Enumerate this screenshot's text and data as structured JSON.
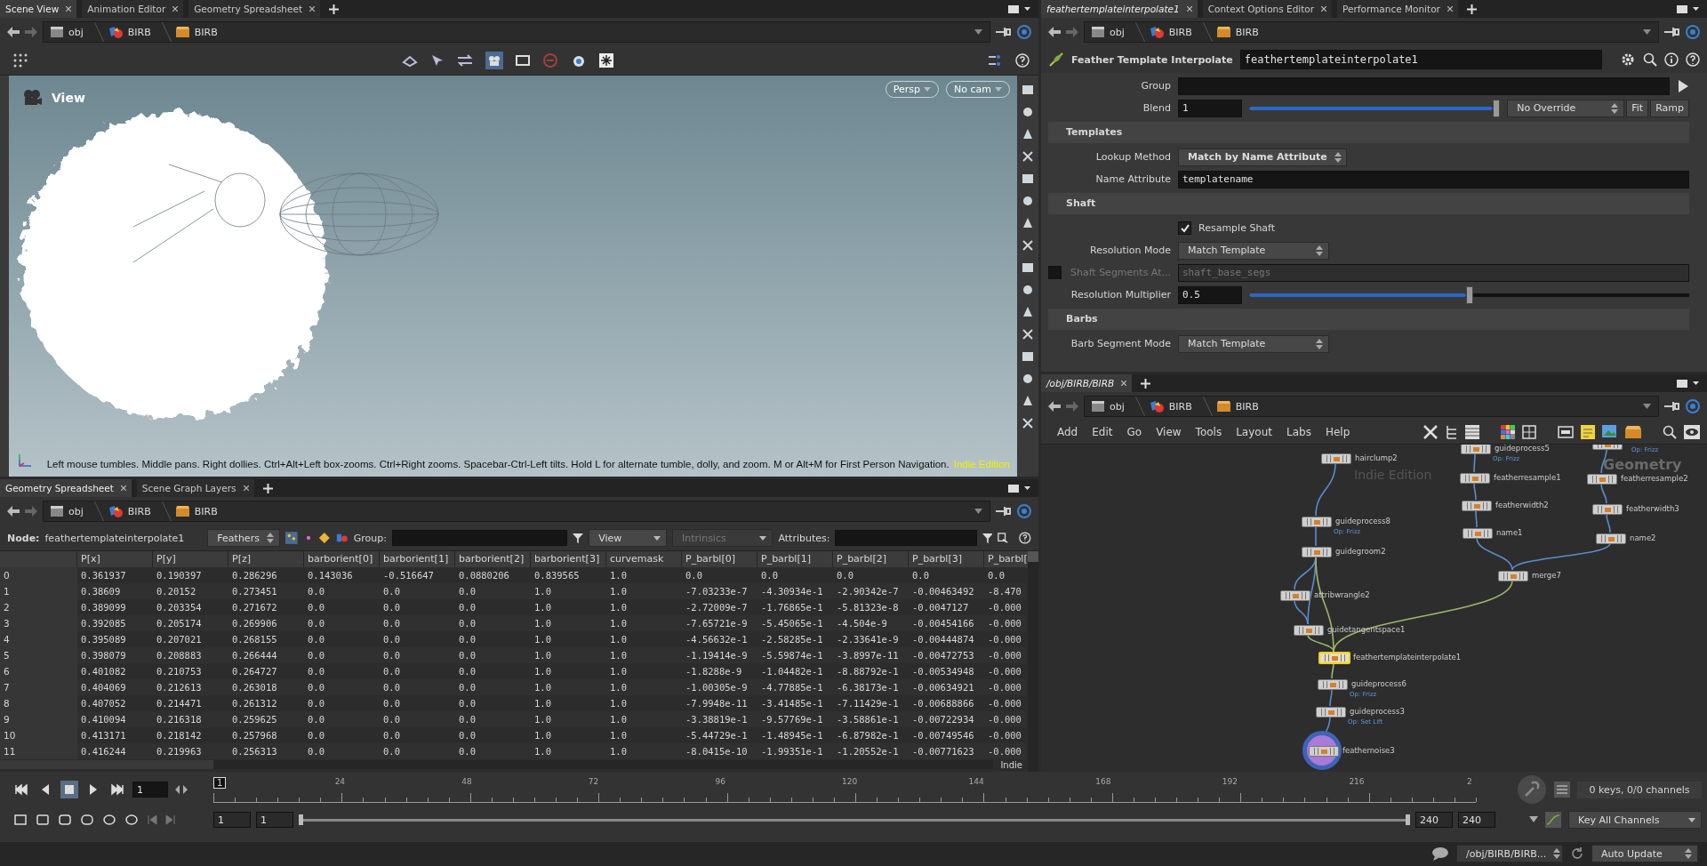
{
  "scene_tabs": [
    {
      "label": "Scene View",
      "selected": true
    },
    {
      "label": "Animation Editor",
      "selected": false
    },
    {
      "label": "Geometry Spreadsheet",
      "selected": false
    }
  ],
  "scene_path": [
    "obj",
    "BIRB",
    "BIRB"
  ],
  "viewport": {
    "title": "View",
    "camera_buttons": [
      "Persp",
      "No cam"
    ],
    "hint": "Left mouse tumbles. Middle pans. Right dollies. Ctrl+Alt+Left box-zooms. Ctrl+Right zooms. Spacebar-Ctrl-Left tilts. Hold L for alternate tumble, dolly, and zoom. M or Alt+M for First Person Navigation.",
    "edition": "Indie Edition"
  },
  "sheet_tabs": [
    {
      "label": "Geometry Spreadsheet",
      "selected": true
    },
    {
      "label": "Scene Graph Layers",
      "selected": false
    }
  ],
  "sheet_path": [
    "obj",
    "BIRB",
    "BIRB"
  ],
  "sheet_toolbar": {
    "node_label": "Node:",
    "node": "feathertemplateinterpolate1",
    "class_menu": "Feathers",
    "group_label": "Group:",
    "view_menu": "View",
    "intrinsics_menu": "Intrinsics",
    "attributes_label": "Attributes:"
  },
  "table": {
    "columns": [
      "",
      "P[x]",
      "P[y]",
      "P[z]",
      "barborient[0]",
      "barborient[1]",
      "barborient[2]",
      "barborient[3]",
      "curvemask",
      "P_barbl[0]",
      "P_barbl[1]",
      "P_barbl[2]",
      "P_barbl[3]",
      "P_barbl["
    ],
    "rows": [
      [
        "0",
        "0.361937",
        "0.190397",
        "0.286296",
        "0.143036",
        "-0.516647",
        "0.0880206",
        "0.839565",
        "1.0",
        "0.0",
        "0.0",
        "0.0",
        "0.0",
        "0.0"
      ],
      [
        "1",
        "0.38609",
        "0.20152",
        "0.273451",
        "0.0",
        "0.0",
        "0.0",
        "1.0",
        "1.0",
        "-7.03233e-7",
        "-4.30934e-1",
        "-2.90342e-7",
        "-0.00463492",
        "-8.470"
      ],
      [
        "2",
        "0.389099",
        "0.203354",
        "0.271672",
        "0.0",
        "0.0",
        "0.0",
        "1.0",
        "1.0",
        "-2.72009e-7",
        "-1.76865e-1",
        "-5.81323e-8",
        "-0.0047127",
        "-0.000"
      ],
      [
        "3",
        "0.392085",
        "0.205174",
        "0.269906",
        "0.0",
        "0.0",
        "0.0",
        "1.0",
        "1.0",
        "-7.65721e-9",
        "-5.45065e-1",
        "-4.504e-9",
        "-0.00454166",
        "-0.000"
      ],
      [
        "4",
        "0.395089",
        "0.207021",
        "0.268155",
        "0.0",
        "0.0",
        "0.0",
        "1.0",
        "1.0",
        "-4.56632e-1",
        "-2.58285e-1",
        "-2.33641e-9",
        "-0.00444874",
        "-0.000"
      ],
      [
        "5",
        "0.398079",
        "0.208883",
        "0.266444",
        "0.0",
        "0.0",
        "0.0",
        "1.0",
        "1.0",
        "-1.19414e-9",
        "-5.59874e-1",
        "-3.8997e-11",
        "-0.00472753",
        "-0.000"
      ],
      [
        "6",
        "0.401082",
        "0.210753",
        "0.264727",
        "0.0",
        "0.0",
        "0.0",
        "1.0",
        "1.0",
        "-1.8288e-9",
        "-1.04482e-1",
        "-8.88792e-1",
        "-0.00534948",
        "-0.000"
      ],
      [
        "7",
        "0.404069",
        "0.212613",
        "0.263018",
        "0.0",
        "0.0",
        "0.0",
        "1.0",
        "1.0",
        "-1.00305e-9",
        "-4.77885e-1",
        "-6.38173e-1",
        "-0.00634921",
        "-0.000"
      ],
      [
        "8",
        "0.407052",
        "0.214471",
        "0.261312",
        "0.0",
        "0.0",
        "0.0",
        "1.0",
        "1.0",
        "-7.9948e-11",
        "-3.41485e-1",
        "-7.11429e-1",
        "-0.00688866",
        "-0.000"
      ],
      [
        "9",
        "0.410094",
        "0.216318",
        "0.259625",
        "0.0",
        "0.0",
        "0.0",
        "1.0",
        "1.0",
        "-3.38819e-1",
        "-9.57769e-1",
        "-3.58861e-1",
        "-0.00722934",
        "-0.000"
      ],
      [
        "10",
        "0.413171",
        "0.218142",
        "0.257968",
        "0.0",
        "0.0",
        "0.0",
        "1.0",
        "1.0",
        "-5.44729e-1",
        "-1.48945e-1",
        "-6.87982e-1",
        "-0.00749546",
        "-0.000"
      ],
      [
        "11",
        "0.416244",
        "0.219963",
        "0.256313",
        "0.0",
        "0.0",
        "0.0",
        "1.0",
        "1.0",
        "-8.0415e-10",
        "-1.99351e-1",
        "-1.20552e-1",
        "-0.00771623",
        "-0.000"
      ]
    ],
    "corner_label": "Indie"
  },
  "param_tabs": [
    {
      "label": "feathertemplateinterpolate1",
      "selected": true
    },
    {
      "label": "Context Options Editor",
      "selected": false
    },
    {
      "label": "Performance Monitor",
      "selected": false
    }
  ],
  "param_path": [
    "obj",
    "BIRB",
    "BIRB"
  ],
  "node_header": {
    "type": "Feather Template Interpolate",
    "name": "feathertemplateinterpolate1"
  },
  "parameters": [
    {
      "kind": "field",
      "label": "Group"
    },
    {
      "kind": "slider",
      "label": "Blend",
      "value": "1",
      "level": 1,
      "menu": "No Override",
      "buttons": [
        "Fit",
        "Ramp"
      ]
    },
    {
      "kind": "section",
      "label": "Templates"
    },
    {
      "kind": "menu",
      "label": "Lookup Method",
      "value": "Match by Name Attribute"
    },
    {
      "kind": "field",
      "label": "Name Attribute",
      "value": "templatename"
    },
    {
      "kind": "section",
      "label": "Shaft"
    },
    {
      "kind": "checkbox",
      "label": "Resample Shaft",
      "checked": true
    },
    {
      "kind": "menu",
      "label": "Resolution Mode",
      "value": "Match Template"
    },
    {
      "kind": "toggle_field",
      "label": "Shaft Segments At...",
      "value": "shaft_base_segs",
      "checked": false,
      "disabled": true
    },
    {
      "kind": "slider",
      "label": "Resolution Multiplier",
      "value": "0.5",
      "level": 0.5
    },
    {
      "kind": "section",
      "label": "Barbs"
    },
    {
      "kind": "menu",
      "label": "Barb Segment Mode",
      "value": "Match Template"
    }
  ],
  "network_tabs": [
    {
      "label": "/obj/BIRB/BIRB",
      "selected": true
    }
  ],
  "network_path": [
    "obj",
    "BIRB",
    "BIRB"
  ],
  "network_menu": [
    "Add",
    "Edit",
    "Go",
    "View",
    "Tools",
    "Layout",
    "Labs",
    "Help"
  ],
  "network": {
    "watermark": "Indie Edition",
    "context": "Geometry",
    "nodes": [
      {
        "name": "hairclump2",
        "selected": false,
        "display": false
      },
      {
        "name": "guideprocess5",
        "comment": "Op: Frizz",
        "selected": false,
        "display": false
      },
      {
        "comment": "Op: Frizz",
        "selected": false,
        "display": false
      },
      {
        "name": "featherresample1",
        "selected": false,
        "display": false
      },
      {
        "name": "featherresample2",
        "selected": false,
        "display": false
      },
      {
        "name": "featherwidth2",
        "selected": false,
        "display": false
      },
      {
        "name": "featherwidth3",
        "selected": false,
        "display": false
      },
      {
        "name": "name1",
        "selected": false,
        "display": false
      },
      {
        "name": "name2",
        "selected": false,
        "display": false
      },
      {
        "name": "guideprocess8",
        "comment": "Op: Frizz",
        "selected": false,
        "display": false
      },
      {
        "name": "guidegroom2",
        "selected": false,
        "display": false
      },
      {
        "name": "merge7",
        "selected": false,
        "display": false
      },
      {
        "name": "attribwrangle2",
        "selected": false,
        "display": false
      },
      {
        "name": "guidetangentspace1",
        "selected": false,
        "display": false
      },
      {
        "name": "feathertemplateinterpolate1",
        "selected": true,
        "display": false
      },
      {
        "name": "guideprocess6",
        "comment": "Op: Frizz",
        "selected": false,
        "display": false
      },
      {
        "name": "guideprocess3",
        "comment": "Op: Set Lift",
        "selected": false,
        "display": false
      },
      {
        "name": "feathernoise3",
        "selected": false,
        "display": true
      }
    ]
  },
  "timeline": {
    "frame": "1",
    "current_marker": "1",
    "ruler_labels": [
      "24",
      "48",
      "72",
      "96",
      "120",
      "144",
      "168",
      "192",
      "216",
      "2"
    ],
    "range_start": "1",
    "range_start_2": "1",
    "range_end": "240",
    "range_end_2": "240",
    "keys_info": "0 keys, 0/0 channels",
    "key_button": "Key All Channels"
  },
  "status_bar": {
    "path": "/obj/BIRB/BIRB...",
    "update_mode": "Auto Update"
  }
}
